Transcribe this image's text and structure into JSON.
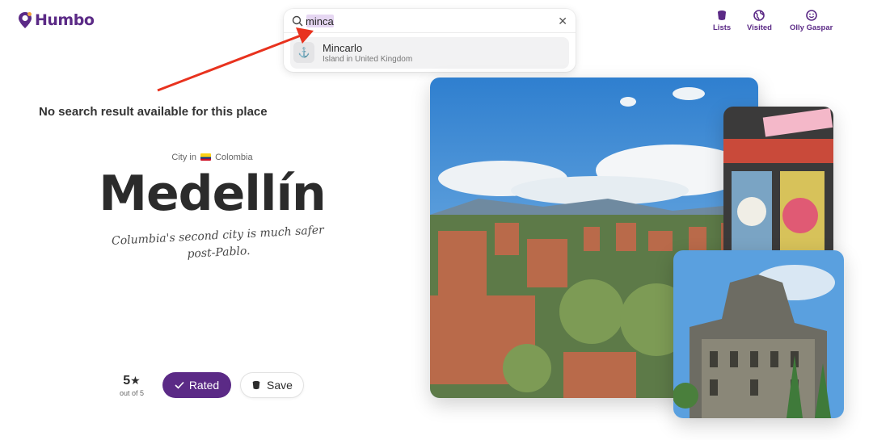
{
  "header": {
    "brand": "Humbo",
    "search": {
      "query": "minca"
    },
    "results": [
      {
        "title": "Mincarlo",
        "subtitle": "Island in United Kingdom",
        "icon": "anchor-icon"
      }
    ],
    "nav": [
      {
        "label": "Lists",
        "icon": "bucket-icon"
      },
      {
        "label": "Visited",
        "icon": "globe-icon"
      },
      {
        "label": "Olly Gaspar",
        "icon": "smiley-icon"
      }
    ]
  },
  "message": "No search result available for this place",
  "place": {
    "type_prefix": "City in",
    "country": "Colombia",
    "name": "Medellín",
    "tagline": "Columbia's second city is much safer post-Pablo."
  },
  "rating": {
    "value": "5",
    "star": "★",
    "out_of": "out of 5"
  },
  "actions": {
    "rated_label": "Rated",
    "save_label": "Save"
  },
  "colors": {
    "brand": "#5b2a86",
    "arrow": "#e8321e"
  }
}
